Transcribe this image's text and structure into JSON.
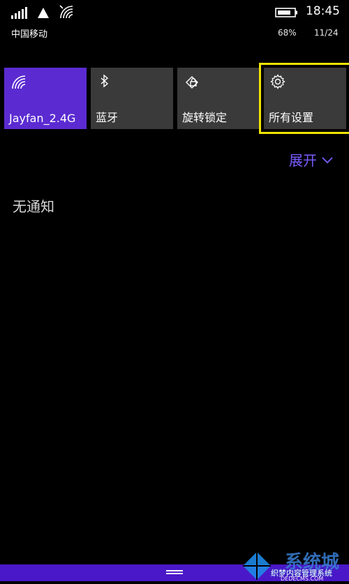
{
  "status_bar": {
    "carrier": "中国移动",
    "time": "18:45",
    "battery_percent": "68%",
    "date": "11/24",
    "icons": [
      "signal-icon",
      "network-triangle-icon",
      "wifi-icon",
      "battery-icon"
    ]
  },
  "tiles": [
    {
      "label": "Jayfan_2.4G",
      "icon": "wifi-icon",
      "active": true
    },
    {
      "label": "蓝牙",
      "icon": "bluetooth-icon",
      "active": false
    },
    {
      "label": "旋转锁定",
      "icon": "rotation-lock-icon",
      "active": false
    },
    {
      "label": "所有设置",
      "icon": "gear-icon",
      "active": false,
      "highlighted": true
    }
  ],
  "expand": {
    "label": "展开"
  },
  "notifications": {
    "empty_text": "无通知"
  },
  "watermark": {
    "big_text": "系统城",
    "cn_text": "织梦内容管理系统",
    "en_text": "DEDECMS.COM"
  },
  "colors": {
    "accent": "#5b2bd1",
    "tile_bg": "#3a3a3a",
    "highlight": "#f0e400",
    "expand_text": "#7b5cff",
    "bottom_bar": "#4a18c8"
  }
}
